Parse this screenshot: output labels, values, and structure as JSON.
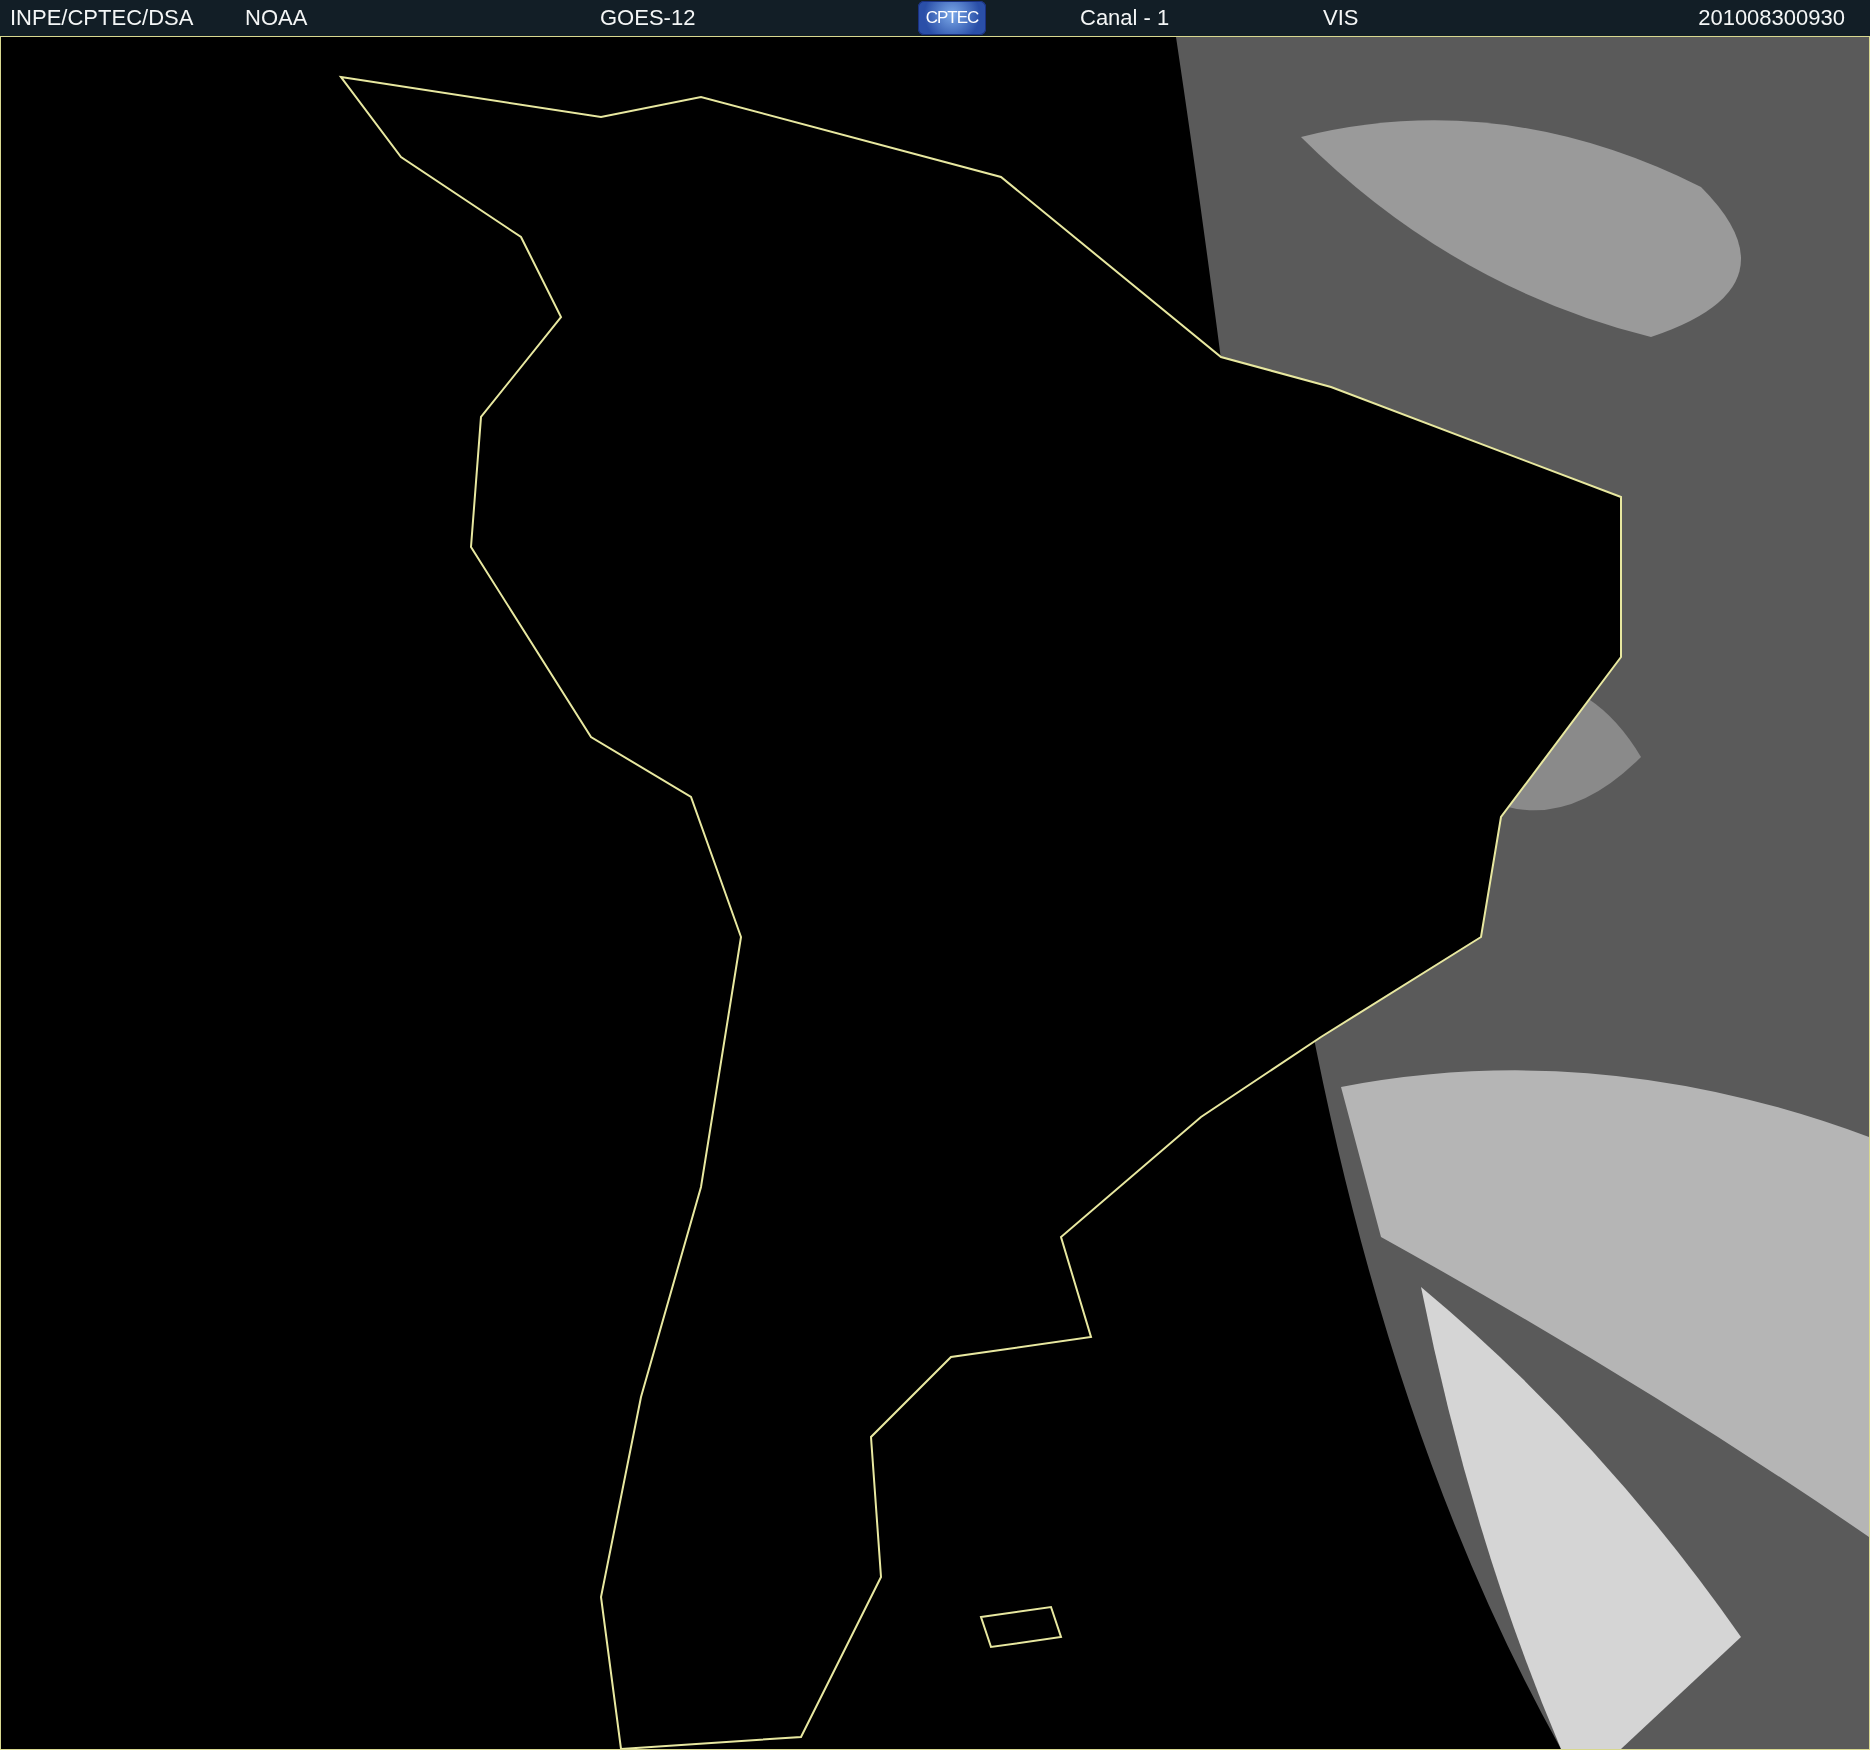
{
  "header": {
    "items": [
      {
        "kind": "text",
        "label": "INPE/CPTEC/DSA"
      },
      {
        "kind": "text",
        "label": "NOAA"
      },
      {
        "kind": "text",
        "label": "GOES-12"
      },
      {
        "kind": "logo",
        "label": "CPTEC"
      },
      {
        "kind": "text",
        "label": "Canal - 1"
      },
      {
        "kind": "text",
        "label": "VIS"
      },
      {
        "kind": "text",
        "label": "201008300930"
      }
    ]
  }
}
